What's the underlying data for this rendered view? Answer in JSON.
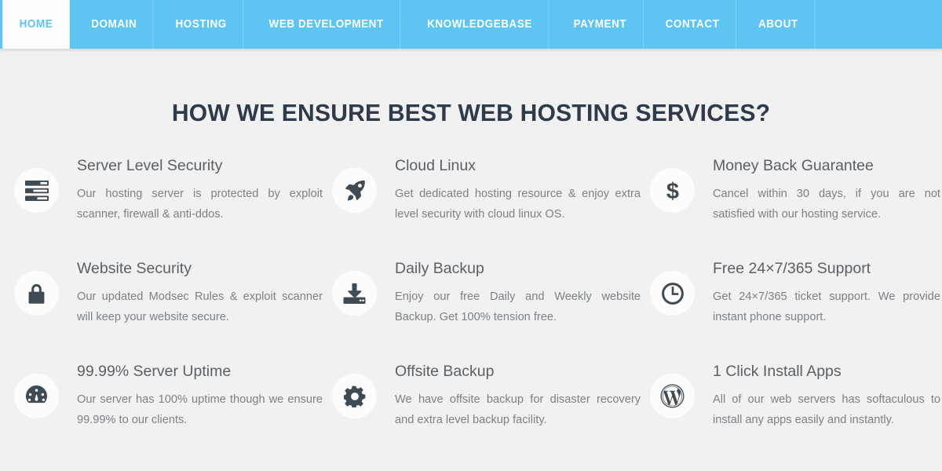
{
  "nav": {
    "items": [
      {
        "label": "HOME",
        "name": "nav-item-home",
        "active": true
      },
      {
        "label": "DOMAIN",
        "name": "nav-item-domain",
        "active": false
      },
      {
        "label": "HOSTING",
        "name": "nav-item-hosting",
        "active": false
      },
      {
        "label": "WEB DEVELOPMENT",
        "name": "nav-item-web-development",
        "active": false
      },
      {
        "label": "KNOWLEDGEBASE",
        "name": "nav-item-knowledgebase",
        "active": false
      },
      {
        "label": "PAYMENT",
        "name": "nav-item-payment",
        "active": false
      },
      {
        "label": "CONTACT",
        "name": "nav-item-contact",
        "active": false
      },
      {
        "label": "ABOUT",
        "name": "nav-item-about",
        "active": false
      }
    ]
  },
  "section": {
    "title": "HOW WE ENSURE BEST WEB HOSTING SERVICES?",
    "features": [
      {
        "icon": "server-rack-icon",
        "title": "Server Level Security",
        "desc": "Our hosting server is protected by exploit scanner, firewall & anti-ddos."
      },
      {
        "icon": "rocket-icon",
        "title": "Cloud Linux",
        "desc": "Get dedicated hosting resource & enjoy extra level security with cloud linux OS."
      },
      {
        "icon": "dollar-sign-icon",
        "title": "Money Back Guarantee",
        "desc": "Cancel within 30 days, if you are not satisfied with our hosting service."
      },
      {
        "icon": "padlock-icon",
        "title": "Website Security",
        "desc": "Our updated Modsec Rules & exploit scanner will keep your website secure."
      },
      {
        "icon": "download-drive-icon",
        "title": "Daily Backup",
        "desc": "Enjoy our free Daily and Weekly website Backup. Get 100% tension free."
      },
      {
        "icon": "clock-icon",
        "title": "Free 24×7/365 Support",
        "desc": "Get 24×7/365 ticket support. We provide instant phone support."
      },
      {
        "icon": "gauge-icon",
        "title": "99.99% Server Uptime",
        "desc": "Our server has 100% uptime though we ensure 99.99% to our clients."
      },
      {
        "icon": "gear-icon",
        "title": "Offsite Backup",
        "desc": "We have offsite backup for disaster recovery and extra level backup facility."
      },
      {
        "icon": "wordpress-icon",
        "title": "1 Click Install Apps",
        "desc": "All of our web servers has softaculous to install any apps easily and instantly."
      }
    ]
  },
  "colors": {
    "nav_blue": "#5ec4f2",
    "nav_active_bg": "#fdfdfd",
    "page_bg": "#f1f1f1",
    "heading": "#2f3a4a",
    "icon": "#3f4a52",
    "title_text": "#5a6068",
    "body_text": "#7b8188"
  }
}
